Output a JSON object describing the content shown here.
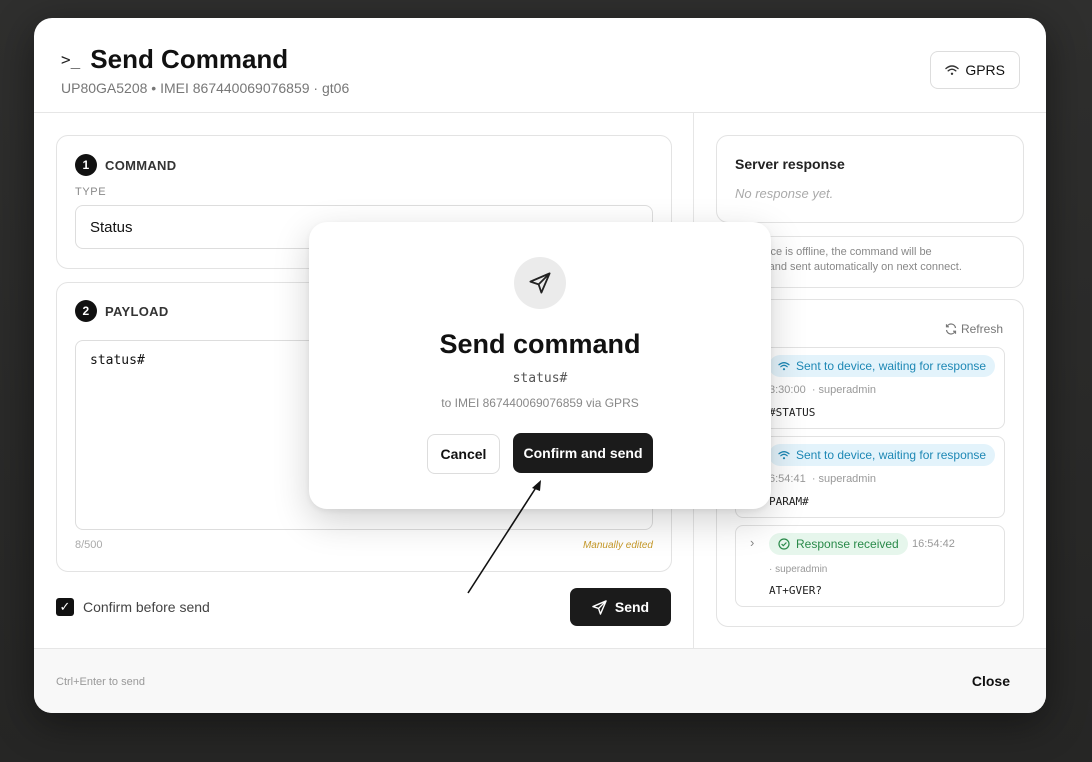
{
  "modal": {
    "title": "Send Command",
    "subtitle": "UP80GA5208 • IMEI 867440069076859 · gt06",
    "channel_label": "GPRS"
  },
  "command_section": {
    "step": "1",
    "label": "COMMAND",
    "type_label": "TYPE",
    "type_value": "Status"
  },
  "payload_section": {
    "step": "2",
    "label": "PAYLOAD",
    "value": "status#",
    "char_count": "8/500",
    "edit_state": "Manually edited"
  },
  "confirm_before_send": {
    "label": "Confirm before send",
    "checked": true
  },
  "send_button": "Send",
  "server_response": {
    "title": "Server response",
    "empty_text": "No response yet."
  },
  "offline_note": "he device is offline, the command will be\nueued and sent automatically on next connect.",
  "history": {
    "title": "ry",
    "refresh_label": "Refresh",
    "items": [
      {
        "status": "Sent to device, waiting for response",
        "time": "3:30:00",
        "user": "· superadmin",
        "command": "#STATUS"
      },
      {
        "status": "Sent to device, waiting for response",
        "time": "6:54:41",
        "user": "· superadmin",
        "command": "PARAM#"
      },
      {
        "status": "Response received",
        "time": "16:54:42",
        "user": "· superadmin",
        "command": "AT+GVER?"
      }
    ]
  },
  "footer": {
    "hint": "Ctrl+Enter to send",
    "close_label": "Close"
  },
  "dialog": {
    "title": "Send command",
    "command": "status#",
    "target": "to IMEI 867440069076859 via GPRS",
    "cancel_label": "Cancel",
    "confirm_label": "Confirm and send"
  },
  "colors": {
    "backdrop": "#2b2b2b",
    "primary_button": "#1b1b1b",
    "waiting_badge_bg": "#e3f3fb",
    "waiting_badge_text": "#1e88b5",
    "received_badge_bg": "#e6f6ec",
    "received_badge_text": "#2a8a4a",
    "manual_edit": "#c79a2a"
  },
  "icons": {
    "title": "terminal-icon",
    "channel": "wifi-icon",
    "send": "send-icon",
    "refresh": "refresh-icon",
    "received": "check-circle-icon",
    "expand": "chevron-right-icon"
  }
}
